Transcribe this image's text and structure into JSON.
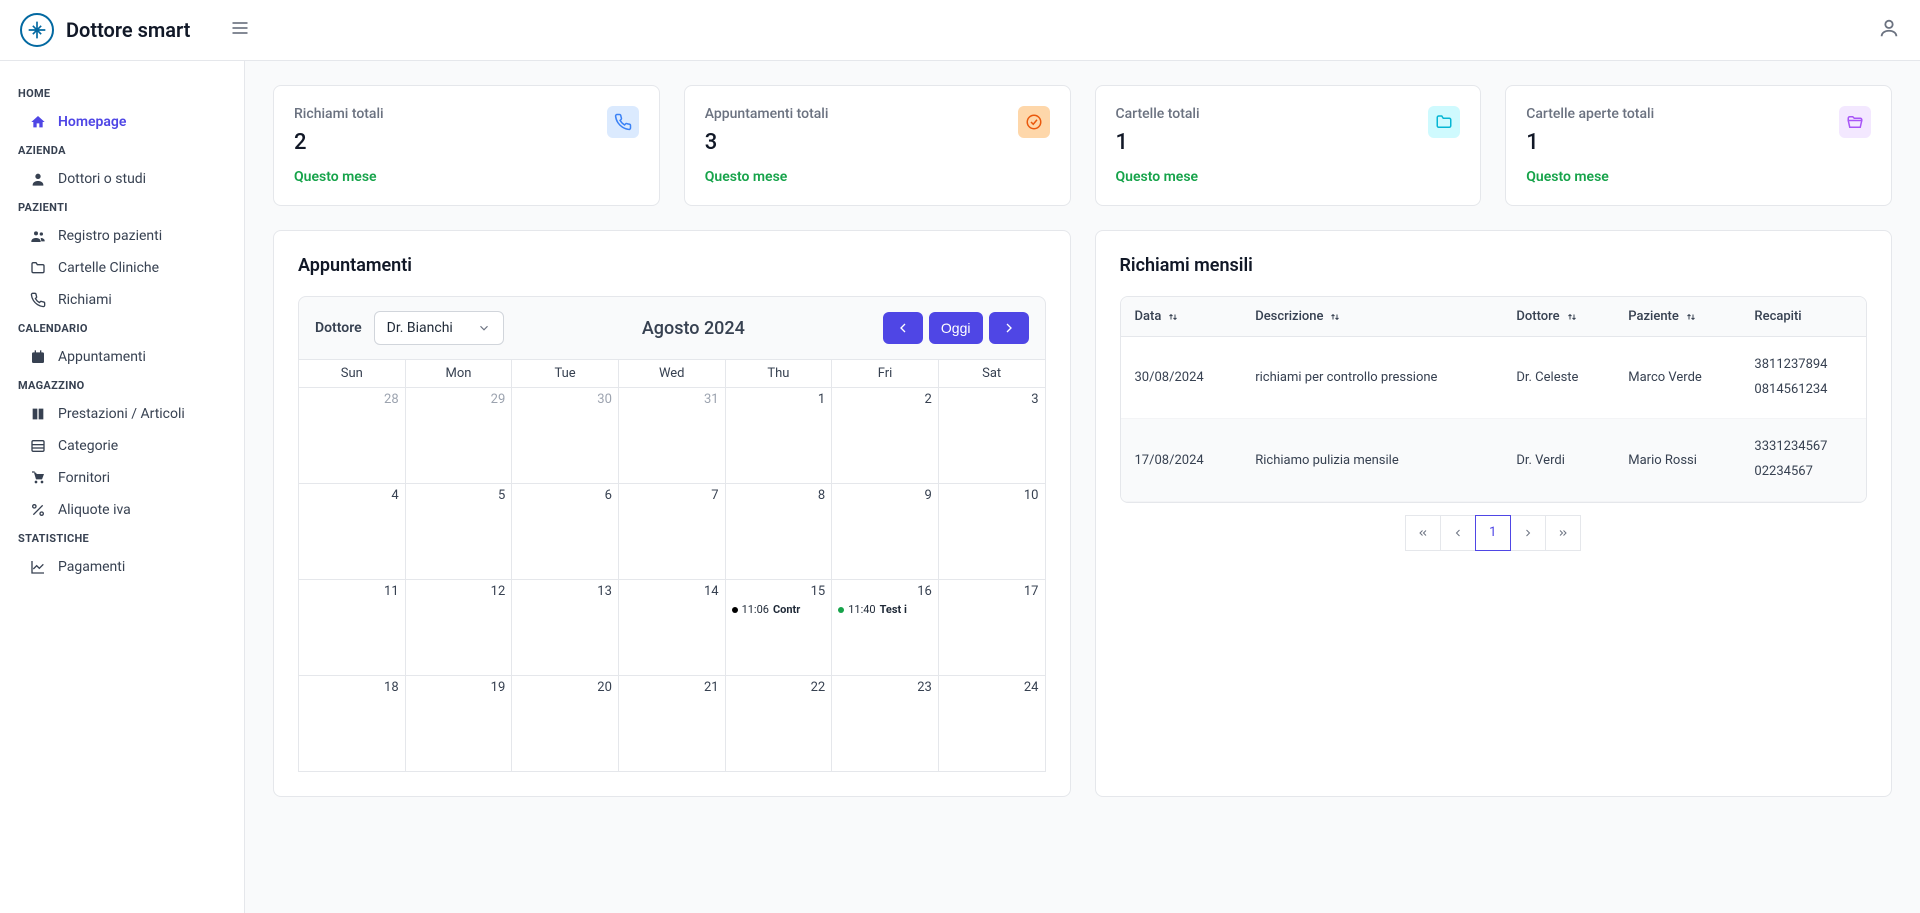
{
  "brand": "Dottore smart",
  "sidebar": {
    "sections": [
      {
        "title": "HOME",
        "items": [
          {
            "label": "Homepage",
            "icon": "home",
            "active": true
          }
        ]
      },
      {
        "title": "AZIENDA",
        "items": [
          {
            "label": "Dottori o studi",
            "icon": "user"
          }
        ]
      },
      {
        "title": "PAZIENTI",
        "items": [
          {
            "label": "Registro pazienti",
            "icon": "users"
          },
          {
            "label": "Cartelle Cliniche",
            "icon": "folder"
          },
          {
            "label": "Richiami",
            "icon": "phone"
          }
        ]
      },
      {
        "title": "CALENDARIO",
        "items": [
          {
            "label": "Appuntamenti",
            "icon": "calendar"
          }
        ]
      },
      {
        "title": "MAGAZZINO",
        "items": [
          {
            "label": "Prestazioni / Articoli",
            "icon": "book"
          },
          {
            "label": "Categorie",
            "icon": "list"
          },
          {
            "label": "Fornitori",
            "icon": "cart"
          },
          {
            "label": "Aliquote iva",
            "icon": "percent"
          }
        ]
      },
      {
        "title": "STATISTICHE",
        "items": [
          {
            "label": "Pagamenti",
            "icon": "chart"
          }
        ]
      }
    ]
  },
  "stats": [
    {
      "label": "Richiami totali",
      "value": "2",
      "sub": "Questo mese",
      "icon": "phone",
      "bg": "#dbeafe",
      "fg": "#3b82f6"
    },
    {
      "label": "Appuntamenti totali",
      "value": "3",
      "sub": "Questo mese",
      "icon": "check",
      "bg": "#fed7aa",
      "fg": "#ea580c"
    },
    {
      "label": "Cartelle totali",
      "value": "1",
      "sub": "Questo mese",
      "icon": "folder",
      "bg": "#cffafe",
      "fg": "#06b6d4"
    },
    {
      "label": "Cartelle aperte totali",
      "value": "1",
      "sub": "Questo mese",
      "icon": "folder-open",
      "bg": "#f3e8ff",
      "fg": "#a855f7"
    }
  ],
  "appointments": {
    "title": "Appuntamenti",
    "doctor_label": "Dottore",
    "doctor_selected": "Dr. Bianchi",
    "month": "Agosto 2024",
    "today_label": "Oggi",
    "weekdays": [
      "Sun",
      "Mon",
      "Tue",
      "Wed",
      "Thu",
      "Fri",
      "Sat"
    ],
    "cells": [
      {
        "d": "28",
        "m": true
      },
      {
        "d": "29",
        "m": true
      },
      {
        "d": "30",
        "m": true
      },
      {
        "d": "31",
        "m": true
      },
      {
        "d": "1"
      },
      {
        "d": "2"
      },
      {
        "d": "3"
      },
      {
        "d": "4"
      },
      {
        "d": "5"
      },
      {
        "d": "6"
      },
      {
        "d": "7"
      },
      {
        "d": "8"
      },
      {
        "d": "9"
      },
      {
        "d": "10"
      },
      {
        "d": "11"
      },
      {
        "d": "12"
      },
      {
        "d": "13"
      },
      {
        "d": "14"
      },
      {
        "d": "15",
        "events": [
          {
            "time": "11:06",
            "title": "Contr",
            "color": "#000000"
          }
        ]
      },
      {
        "d": "16",
        "events": [
          {
            "time": "11:40",
            "title": "Test i",
            "color": "#16a34a"
          }
        ]
      },
      {
        "d": "17"
      },
      {
        "d": "18"
      },
      {
        "d": "19"
      },
      {
        "d": "20"
      },
      {
        "d": "21"
      },
      {
        "d": "22"
      },
      {
        "d": "23"
      },
      {
        "d": "24"
      }
    ]
  },
  "recalls": {
    "title": "Richiami mensili",
    "headers": [
      "Data",
      "Descrizione",
      "Dottore",
      "Paziente",
      "Recapiti"
    ],
    "rows": [
      {
        "data": "30/08/2024",
        "desc": "richiami per controllo pressione",
        "doc": "Dr. Celeste",
        "pat": "Marco Verde",
        "c1": "3811237894",
        "c2": "0814561234"
      },
      {
        "data": "17/08/2024",
        "desc": "Richiamo pulizia mensile",
        "doc": "Dr. Verdi",
        "pat": "Mario Rossi",
        "c1": "3331234567",
        "c2": "02234567"
      }
    ],
    "page": "1"
  }
}
